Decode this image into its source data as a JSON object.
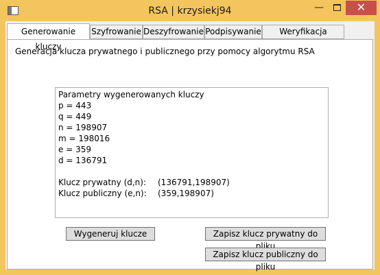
{
  "window": {
    "title": "RSA | krzysiekj94",
    "minimize": "—",
    "close": "✕"
  },
  "tabs": [
    {
      "label": "Generowanie kluczy",
      "active": true
    },
    {
      "label": "Szyfrowanie",
      "active": false
    },
    {
      "label": "Deszyfrowanie",
      "active": false
    },
    {
      "label": "Podpisywanie",
      "active": false
    },
    {
      "label": "Weryfikacja podpisu",
      "active": false
    }
  ],
  "main": {
    "description": "Generacja klucza prywatnego i publicznego przy pomocy algorytmu RSA",
    "output": {
      "heading": "Parametry wygenerowanych kluczy",
      "params": [
        "p = 443",
        "q = 449",
        "n = 198907",
        "m = 198016",
        "e = 359",
        "d = 136791"
      ],
      "private_key_label": "Klucz prywatny (d,n):",
      "private_key_value": "(136791,198907)",
      "public_key_label": "Klucz publiczny (e,n):",
      "public_key_value": "(359,198907)"
    },
    "buttons": {
      "generate": "Wygeneruj klucze",
      "save_private": "Zapisz klucz prywatny do pliku",
      "save_public": "Zapisz klucz publiczny do pliku"
    }
  }
}
